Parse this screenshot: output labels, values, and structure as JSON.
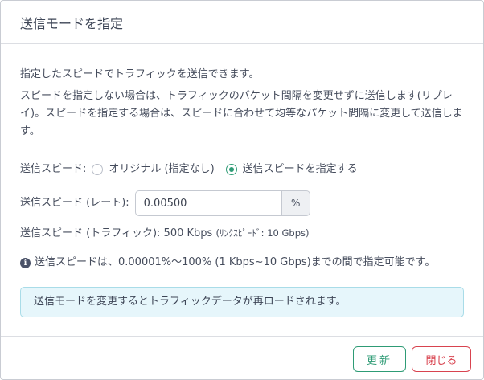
{
  "dialog": {
    "title": "送信モードを指定",
    "description_1": "指定したスピードでトラフィックを送信できます。",
    "description_2": "スピードを指定しない場合は、トラフィックのパケット間隔を変更せずに送信します(リプレイ)。スピードを指定する場合は、スピードに合わせて均等なパケット間隔に変更して送信します。",
    "speed_mode": {
      "label": "送信スピード:",
      "options": [
        "オリジナル (指定なし)",
        "送信スピードを指定する"
      ],
      "selected": "送信スピードを指定する"
    },
    "rate": {
      "label": "送信スピード (レート):",
      "value": "0.00500",
      "unit": "%"
    },
    "traffic": {
      "label": "送信スピード (トラフィック):",
      "value": "500 Kbps",
      "note": "(ﾘﾝｸｽﾋﾟｰﾄﾞ: 10 Gbps)"
    },
    "info": {
      "icon": "info-icon",
      "text": "送信スピードは、0.00001%〜100% (1 Kbps~10 Gbps)までの間で指定可能です。"
    },
    "notice": "送信モードを変更するとトラフィックデータが再ロードされます。",
    "buttons": {
      "update": "更新",
      "close": "閉じる"
    },
    "colors": {
      "accent_green": "#2e9b75",
      "danger_red": "#d8434f",
      "notice_bg": "#e6f6fb"
    }
  }
}
